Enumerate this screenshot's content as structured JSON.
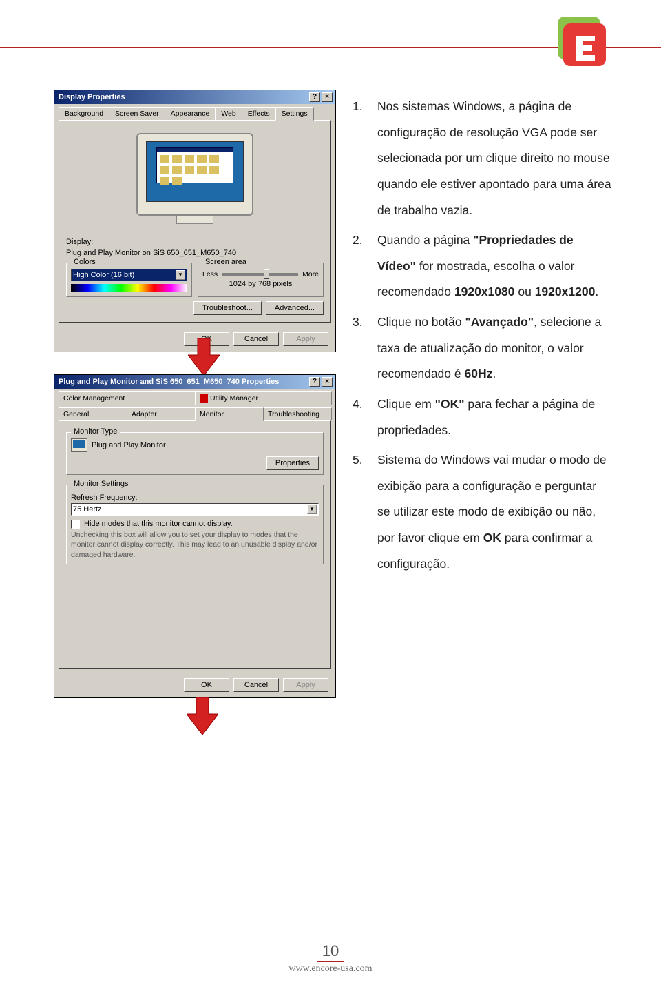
{
  "header": {
    "line_color": "#b22222"
  },
  "logo": {
    "name": "encore-logo",
    "color1": "#8bc34a",
    "color2": "#e53935"
  },
  "dialog1": {
    "title": "Display Properties",
    "tabs": [
      "Background",
      "Screen Saver",
      "Appearance",
      "Web",
      "Effects",
      "Settings"
    ],
    "active_tab": "Settings",
    "display_label": "Display:",
    "display_value": "Plug and Play Monitor on SiS 650_651_M650_740",
    "colors_label": "Colors",
    "colors_value": "High Color (16 bit)",
    "screen_area_label": "Screen area",
    "less": "Less",
    "more": "More",
    "resolution": "1024 by 768 pixels",
    "troubleshoot": "Troubleshoot...",
    "advanced": "Advanced...",
    "ok": "OK",
    "cancel": "Cancel",
    "apply": "Apply"
  },
  "dialog2": {
    "title": "Plug and Play Monitor and SiS 650_651_M650_740 Properties",
    "tabs_row1": [
      "Color Management",
      "Utility Manager"
    ],
    "tabs_row2": [
      "General",
      "Adapter",
      "Monitor",
      "Troubleshooting"
    ],
    "active_tab": "Monitor",
    "monitor_type_label": "Monitor Type",
    "monitor_type_value": "Plug and Play Monitor",
    "properties_btn": "Properties",
    "monitor_settings_label": "Monitor Settings",
    "refresh_label": "Refresh Frequency:",
    "refresh_value": "75 Hertz",
    "hide_modes": "Hide modes that this monitor cannot display.",
    "hint": "Unchecking this box will allow you to set your display to modes that the monitor cannot display correctly. This may lead to an unusable display and/or damaged hardware.",
    "ok": "OK",
    "cancel": "Cancel",
    "apply": "Apply"
  },
  "instructions": {
    "items": [
      {
        "num": "1.",
        "text": "Nos sistemas Windows, a página de configuração de resolução VGA pode ser selecionada por um clique direito no mouse quando ele estiver apontado para uma área de trabalho vazia."
      },
      {
        "num": "2.",
        "text": "Quando a página <b>\"Propriedades de Vídeo\"</b> for mostrada, escolha o valor recomendado <b>1920x1080</b> ou <b>1920x1200</b>."
      },
      {
        "num": "3.",
        "text": "Clique no botão <b>\"Avançado\"</b>, selecione a taxa de atualização do monitor, o valor recomendado é <b>60Hz</b>."
      },
      {
        "num": "4.",
        "text": "Clique em <b>\"OK\"</b> para fechar a página de propriedades."
      },
      {
        "num": "5.",
        "text": "Sistema do Windows vai mudar o modo de exibição para a configuração e perguntar se utilizar este modo de exibição ou não, por favor clique em <b>OK</b> para confirmar a configuração."
      }
    ]
  },
  "footer": {
    "page": "10",
    "url": "www.encore-usa.com"
  }
}
